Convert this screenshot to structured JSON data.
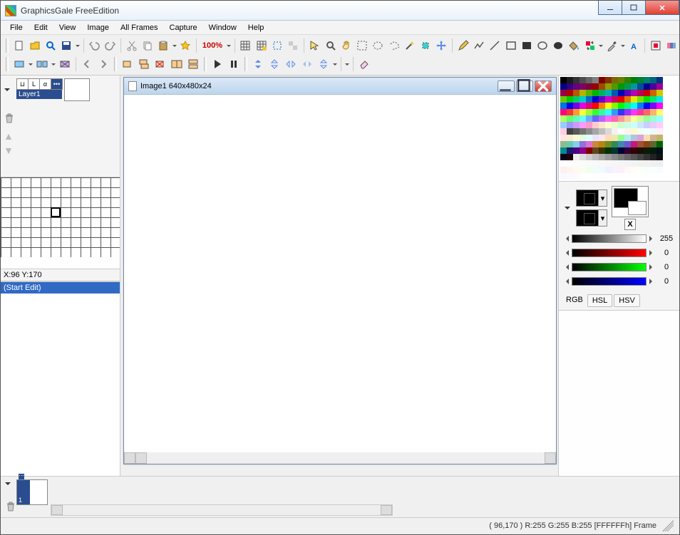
{
  "app": {
    "title": "GraphicsGale FreeEdition"
  },
  "menu": [
    "File",
    "Edit",
    "View",
    "Image",
    "All Frames",
    "Capture",
    "Window",
    "Help"
  ],
  "toolbar": {
    "zoom": "100%"
  },
  "layer": {
    "name": "Layer1",
    "thumbs": [
      "⊔",
      "L",
      "α",
      "•••"
    ]
  },
  "preview": {
    "coords": "X:96 Y:170"
  },
  "edit_panel": {
    "title": "(Start Edit)"
  },
  "document": {
    "title": "Image1 640x480x24"
  },
  "sliders": {
    "gray": "255",
    "r": "0",
    "g": "0",
    "b": "0"
  },
  "color_modes": {
    "rgb": "RGB",
    "hsl": "HSL",
    "hsv": "HSV"
  },
  "swap": "X",
  "frame": {
    "number": "1"
  },
  "status": {
    "text": "( 96,170 )  R:255 G:255 B:255  [FFFFFFh]  Frame"
  },
  "palette_colors": [
    "#000000",
    "#1a1a1a",
    "#333333",
    "#4d4d4d",
    "#666666",
    "#808080",
    "#800000",
    "#803300",
    "#806600",
    "#668000",
    "#338000",
    "#008000",
    "#008033",
    "#008066",
    "#006680",
    "#003380",
    "#000080",
    "#330080",
    "#660080",
    "#800066",
    "#800033",
    "#990000",
    "#994c00",
    "#999900",
    "#4c9900",
    "#009900",
    "#00994c",
    "#009999",
    "#004c99",
    "#000099",
    "#4c0099",
    "#990099",
    "#99004c",
    "#b30000",
    "#b35900",
    "#b3b300",
    "#59b300",
    "#00b300",
    "#00b359",
    "#00b3b3",
    "#0059b3",
    "#0000b3",
    "#5900b3",
    "#b300b3",
    "#b30059",
    "#cc0000",
    "#cc6600",
    "#cccc00",
    "#66cc00",
    "#00cc00",
    "#00cc66",
    "#00cccc",
    "#0066cc",
    "#0000cc",
    "#6600cc",
    "#cc00cc",
    "#cc0066",
    "#e60000",
    "#e67300",
    "#e6e600",
    "#73e600",
    "#00e600",
    "#00e673",
    "#00e6e6",
    "#0073e6",
    "#0000e6",
    "#7300e6",
    "#e600e6",
    "#e60073",
    "#ff0000",
    "#ff8000",
    "#ffff00",
    "#80ff00",
    "#00ff00",
    "#00ff80",
    "#00ffff",
    "#0080ff",
    "#0000ff",
    "#8000ff",
    "#ff00ff",
    "#ff0080",
    "#ff3333",
    "#ff9933",
    "#ffff33",
    "#99ff33",
    "#33ff33",
    "#33ff99",
    "#33ffff",
    "#3399ff",
    "#3333ff",
    "#9933ff",
    "#ff33ff",
    "#ff3399",
    "#ff6666",
    "#ffb366",
    "#ffff66",
    "#b3ff66",
    "#66ff66",
    "#66ffb3",
    "#66ffff",
    "#66b3ff",
    "#6666ff",
    "#b366ff",
    "#ff66ff",
    "#ff66b3",
    "#ff9999",
    "#ffcc99",
    "#ffff99",
    "#ccff99",
    "#99ff99",
    "#99ffcc",
    "#99ffff",
    "#99ccff",
    "#9999ff",
    "#cc99ff",
    "#ff99ff",
    "#ff99cc",
    "#ffcccc",
    "#ffe6cc",
    "#ffffcc",
    "#e6ffcc",
    "#ccffcc",
    "#ccffe6",
    "#ccffff",
    "#cce6ff",
    "#ccccff",
    "#e6ccff",
    "#ffccff",
    "#ffcce6",
    "#404040",
    "#595959",
    "#737373",
    "#8c8c8c",
    "#a6a6a6",
    "#bfbfbf",
    "#d9d9d9",
    "#f2f2f2",
    "#ffffff",
    "#fff5ee",
    "#fffacd",
    "#f0fff0",
    "#f0ffff",
    "#f0f8ff",
    "#fff0f5",
    "#ffe4e1",
    "#faebd7",
    "#fafad2",
    "#e0ffe0",
    "#e0ffff",
    "#e6e6fa",
    "#ffe4f1",
    "#ffdab9",
    "#eee8aa",
    "#98fb98",
    "#afeeee",
    "#b0c4de",
    "#dda0dd",
    "#f5deb3",
    "#d2b48c",
    "#bdb76b",
    "#8fbc8f",
    "#66cdaa",
    "#87ceeb",
    "#9370db",
    "#da70d6",
    "#cd853f",
    "#b8860b",
    "#6b8e23",
    "#2e8b57",
    "#4682b4",
    "#6a5acd",
    "#c71585",
    "#a0522d",
    "#8b4513",
    "#556b2f",
    "#006400",
    "#008b8b",
    "#191970",
    "#4b0082",
    "#8b008b",
    "#800000",
    "#654321",
    "#333300",
    "#003300",
    "#003333",
    "#000033",
    "#330033",
    "#330000",
    "#1a0d00",
    "#0d1a00",
    "#001a0d",
    "#000d1a",
    "#0d001a",
    "#1a000d",
    "#eeeeee",
    "#dddddd",
    "#cccccc",
    "#bbbbbb",
    "#aaaaaa",
    "#999999",
    "#888888",
    "#777777",
    "#666666",
    "#555555",
    "#444444",
    "#333333",
    "#222222",
    "#111111",
    "#fefefe",
    "#fdfdfd",
    "#fcfcfc",
    "#fbfbfb",
    "#fafafa",
    "#f9f9f9",
    "#f8f8f8",
    "#f7f7f7",
    "#f6f6f6",
    "#f5f5f5",
    "#f4f4f4",
    "#f3f3f3",
    "#f2f2f2",
    "#f1f1f1",
    "#f0f0f0",
    "#efefef",
    "#fef0f0",
    "#fef5f0",
    "#fefaf0",
    "#fafef0",
    "#f0fef0",
    "#f0fefa",
    "#f0fafe",
    "#f0f0fe",
    "#faf0fe",
    "#fef0fa",
    "#fff8f8",
    "#fffcf8",
    "#fcfff8",
    "#f8fff8",
    "#f8fffc",
    "#f8fcff",
    "#f8f8ff",
    "#fcf8ff",
    "#fff8fc",
    "#fffefe",
    "#fefffe",
    "#fefeff",
    "#fffeff",
    "#fffffe",
    "#feffff",
    "#ffffff",
    "#ffffff",
    "#ffffff",
    "#ffffff",
    "#ffffff",
    "#ffffff",
    "#ffffff"
  ]
}
